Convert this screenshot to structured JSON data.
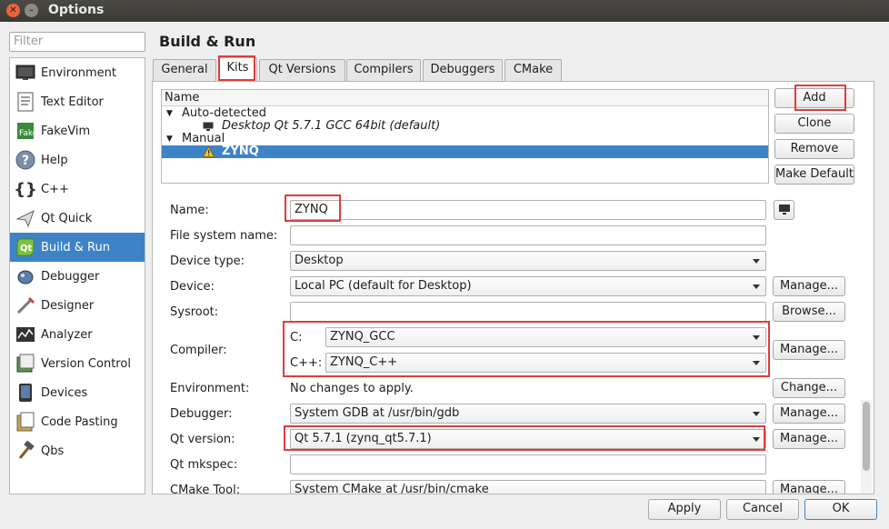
{
  "window": {
    "title": "Options"
  },
  "filter": {
    "placeholder": "Filter"
  },
  "categories": [
    {
      "label": "Environment",
      "icon": "monitor-icon"
    },
    {
      "label": "Text Editor",
      "icon": "text-editor-icon"
    },
    {
      "label": "FakeVim",
      "icon": "fakevim-icon"
    },
    {
      "label": "Help",
      "icon": "help-icon"
    },
    {
      "label": "C++",
      "icon": "braces-icon"
    },
    {
      "label": "Qt Quick",
      "icon": "paper-plane-icon"
    },
    {
      "label": "Build & Run",
      "icon": "qt-icon",
      "selected": true
    },
    {
      "label": "Debugger",
      "icon": "bug-icon"
    },
    {
      "label": "Designer",
      "icon": "designer-icon"
    },
    {
      "label": "Analyzer",
      "icon": "analyzer-icon"
    },
    {
      "label": "Version Control",
      "icon": "version-control-icon"
    },
    {
      "label": "Devices",
      "icon": "device-icon"
    },
    {
      "label": "Code Pasting",
      "icon": "code-pasting-icon"
    },
    {
      "label": "Qbs",
      "icon": "hammer-icon"
    }
  ],
  "page_title": "Build & Run",
  "tabs": [
    "General",
    "Kits",
    "Qt Versions",
    "Compilers",
    "Debuggers",
    "CMake"
  ],
  "active_tab": "Kits",
  "kits_tree": {
    "header": "Name",
    "auto_group": "Auto-detected",
    "auto_item": "Desktop Qt 5.7.1 GCC 64bit (default)",
    "manual_group": "Manual",
    "manual_item": "ZYNQ"
  },
  "side_buttons": {
    "add": "Add",
    "clone": "Clone",
    "remove": "Remove",
    "make_default": "Make Default"
  },
  "form": {
    "name_label": "Name:",
    "name_value": "ZYNQ",
    "fs_label": "File system name:",
    "fs_value": "",
    "device_type_label": "Device type:",
    "device_type_value": "Desktop",
    "device_label": "Device:",
    "device_value": "Local PC (default for Desktop)",
    "sysroot_label": "Sysroot:",
    "sysroot_value": "",
    "compiler_label": "Compiler:",
    "c_label": "C:",
    "c_value": "ZYNQ_GCC",
    "cpp_label": "C++:",
    "cpp_value": "ZYNQ_C++",
    "env_label": "Environment:",
    "env_value": "No changes to apply.",
    "debugger_label": "Debugger:",
    "debugger_value": "System GDB at /usr/bin/gdb",
    "qt_version_label": "Qt version:",
    "qt_version_value": "Qt 5.7.1 (zynq_qt5.7.1)",
    "mkspec_label": "Qt mkspec:",
    "mkspec_value": "",
    "cmake_label": "CMake Tool:",
    "cmake_value": "System CMake at /usr/bin/cmake"
  },
  "form_buttons": {
    "manage": "Manage...",
    "browse": "Browse...",
    "change": "Change..."
  },
  "dialog_buttons": {
    "apply": "Apply",
    "cancel": "Cancel",
    "ok": "OK"
  },
  "colors": {
    "selection": "#3d83c6",
    "highlight": "#e03c3c"
  }
}
